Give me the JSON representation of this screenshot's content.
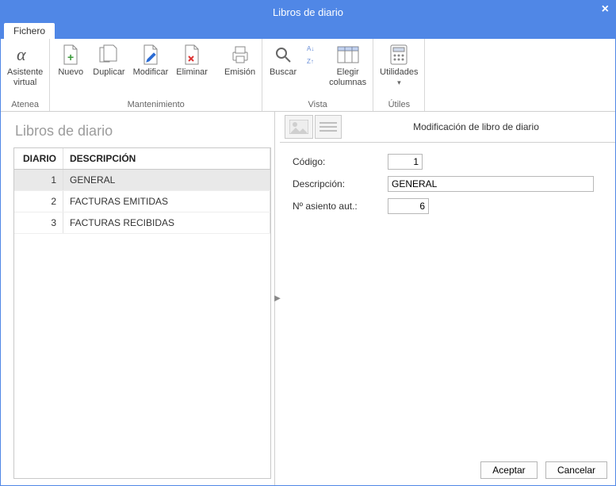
{
  "window": {
    "title": "Libros de diario"
  },
  "tabs": {
    "fichero": "Fichero"
  },
  "ribbon": {
    "groups": [
      {
        "label": "Atenea",
        "items": [
          {
            "label": "Asistente\nvirtual",
            "name": "asistente-virtual-button"
          }
        ]
      },
      {
        "label": "Mantenimiento",
        "items": [
          {
            "label": "Nuevo",
            "name": "nuevo-button"
          },
          {
            "label": "Duplicar",
            "name": "duplicar-button"
          },
          {
            "label": "Modificar",
            "name": "modificar-button"
          },
          {
            "label": "Eliminar",
            "name": "eliminar-button"
          },
          {
            "label": "Emisión",
            "name": "emision-button"
          }
        ]
      },
      {
        "label": "Vista",
        "items": [
          {
            "label": "Buscar",
            "name": "buscar-button"
          },
          {
            "label": "",
            "name": "sort-button"
          },
          {
            "label": "Elegir\ncolumnas",
            "name": "elegir-columnas-button"
          }
        ]
      },
      {
        "label": "Útiles",
        "items": [
          {
            "label": "Utilidades",
            "name": "utilidades-button"
          }
        ]
      }
    ]
  },
  "list": {
    "title": "Libros de diario",
    "columns": {
      "diario": "DIARIO",
      "descripcion": "DESCRIPCIÓN"
    },
    "rows": [
      {
        "diario": "1",
        "descripcion": "GENERAL",
        "selected": true
      },
      {
        "diario": "2",
        "descripcion": "FACTURAS EMITIDAS",
        "selected": false
      },
      {
        "diario": "3",
        "descripcion": "FACTURAS RECIBIDAS",
        "selected": false
      }
    ]
  },
  "detail": {
    "title": "Modificación de libro de diario",
    "fields": {
      "codigo_label": "Código:",
      "codigo_value": "1",
      "descripcion_label": "Descripción:",
      "descripcion_value": "GENERAL",
      "asiento_label": "Nº asiento aut.:",
      "asiento_value": "6"
    },
    "buttons": {
      "accept": "Aceptar",
      "cancel": "Cancelar"
    }
  }
}
